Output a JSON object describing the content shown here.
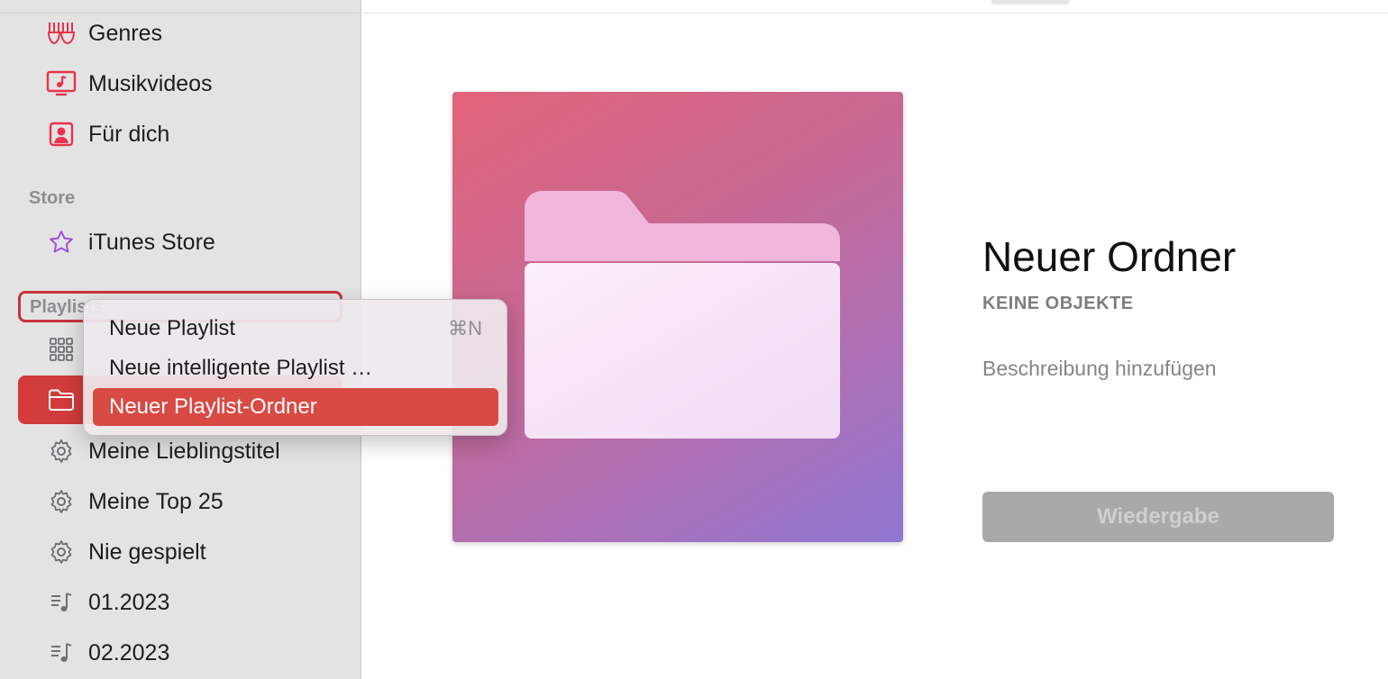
{
  "sidebar": {
    "items_top": [
      {
        "label": "Genres",
        "icon": "genres-icon"
      },
      {
        "label": "Musikvideos",
        "icon": "music-video-icon"
      },
      {
        "label": "Für dich",
        "icon": "for-you-icon"
      }
    ],
    "store_section": "Store",
    "store_items": [
      {
        "label": "iTunes Store",
        "icon": "star-icon"
      }
    ],
    "playlists_section": "Playlists",
    "playlist_items": [
      {
        "label": "Meine Lieblingstitel",
        "icon": "gear-icon"
      },
      {
        "label": "Meine Top 25",
        "icon": "gear-icon"
      },
      {
        "label": "Nie gespielt",
        "icon": "gear-icon"
      },
      {
        "label": "01.2023",
        "icon": "playlist-icon"
      },
      {
        "label": "02.2023",
        "icon": "playlist-icon"
      }
    ]
  },
  "main": {
    "title": "Neuer Ordner",
    "subtitle": "KEINE OBJEKTE",
    "description_placeholder": "Beschreibung hinzufügen",
    "play_button": "Wiedergabe"
  },
  "context_menu": {
    "items": [
      {
        "label": "Neue Playlist",
        "shortcut": "⌘N"
      },
      {
        "label": "Neue intelligente Playlist …",
        "shortcut": ""
      },
      {
        "label": "Neuer Playlist-Ordner",
        "shortcut": "",
        "highlighted": true
      }
    ]
  },
  "colors": {
    "accent": "#d13b3b",
    "menu_highlight": "#d84a44",
    "icon_red": "#e8334a",
    "icon_purple": "#a24fd6"
  }
}
